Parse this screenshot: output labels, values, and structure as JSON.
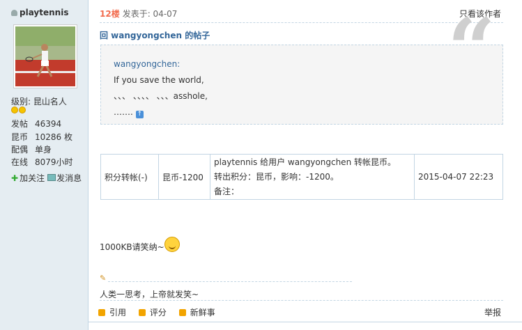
{
  "user": {
    "name": "playtennis",
    "level_label": "级别:",
    "level_value": "昆山名人",
    "stats": [
      {
        "key": "发帖",
        "value": "46394"
      },
      {
        "key": "昆币",
        "value": "10286 枚"
      },
      {
        "key": "配偶",
        "value": "单身"
      },
      {
        "key": "在线",
        "value": "8079小时"
      }
    ],
    "follow_label": "加关注",
    "message_label": "发消息"
  },
  "post": {
    "floor": "12楼",
    "posted_at": "发表于: 04-07",
    "only_author": "只看该作者",
    "reply_title": "回 wangyongchen 的帖子",
    "quote": {
      "author": "wangyongchen:",
      "lines": [
        "If you save the world,",
        "、、、 、、、、 、、、asshole,",
        "……."
      ]
    },
    "rating": {
      "type": "积分转帐(-)",
      "amount": "昆币-1200",
      "desc_lines": [
        "playtennis 给用户 wangyongchen 转帐昆币。",
        "转出积分：昆币，影响：-1200。",
        "备注："
      ],
      "time": "2015-04-07 22:23"
    },
    "body": "1000KB请笑纳~",
    "signature": "人类一思考，上帝就发笑~"
  },
  "footer": {
    "quote_label": "引用",
    "rate_label": "评分",
    "news_label": "新鲜事",
    "report_label": "举报"
  },
  "colors": {
    "sidebar_bg": "#e5edf2",
    "border": "#c2d5e3",
    "link": "#336699",
    "floor": "#f26c4f"
  }
}
